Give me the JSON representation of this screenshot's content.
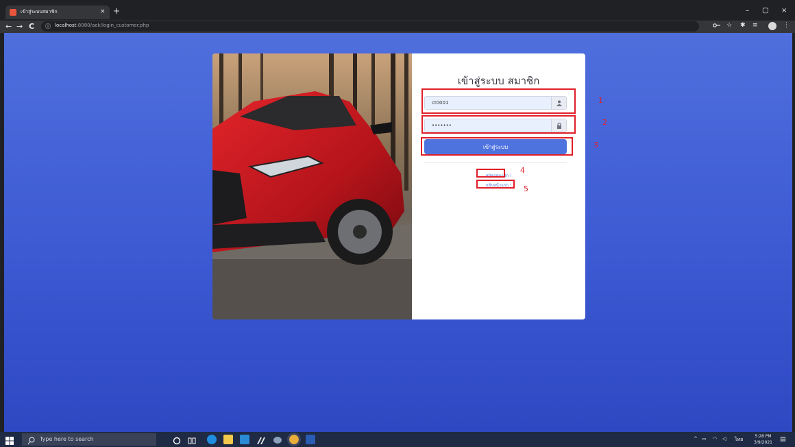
{
  "browser": {
    "tab_title": "เข้าสู่ระบบสมาชิก",
    "tab_close": "×",
    "new_tab": "+",
    "url_host": "localhost",
    "url_path": ":8080/aek/login_customer.php",
    "info_glyph": "ⓘ",
    "back_glyph": "←",
    "forward_glyph": "→",
    "reload_glyph": "C",
    "minimize_glyph": "–",
    "maximize_glyph": "▢",
    "close_glyph": "×",
    "key_icon": "key-icon",
    "star_icon": "star-icon",
    "extensions_icon": "puzzle-icon",
    "playlist_icon": "playlist-icon",
    "menu_glyph": "⋮"
  },
  "login": {
    "title": "เข้าสู่ระบบ สมาชิก",
    "username_value": "ct0001",
    "password_value": "•••••••",
    "login_button": "เข้าสู่ระบบ",
    "register_link": "สมัครสมาชิก !",
    "home_link": "กลับหน้าแรก !"
  },
  "annotations": [
    "1",
    "2",
    "3",
    "4",
    "5"
  ],
  "taskbar": {
    "search_placeholder": "Type here to search",
    "lang": "ไทย",
    "time": "5:28 PM",
    "date": "3/9/2021"
  },
  "colors": {
    "page_gradient_top": "#4f6fdd",
    "page_gradient_bottom": "#2e48c2",
    "primary": "#4e73df",
    "annotation_red": "#e01e28"
  }
}
